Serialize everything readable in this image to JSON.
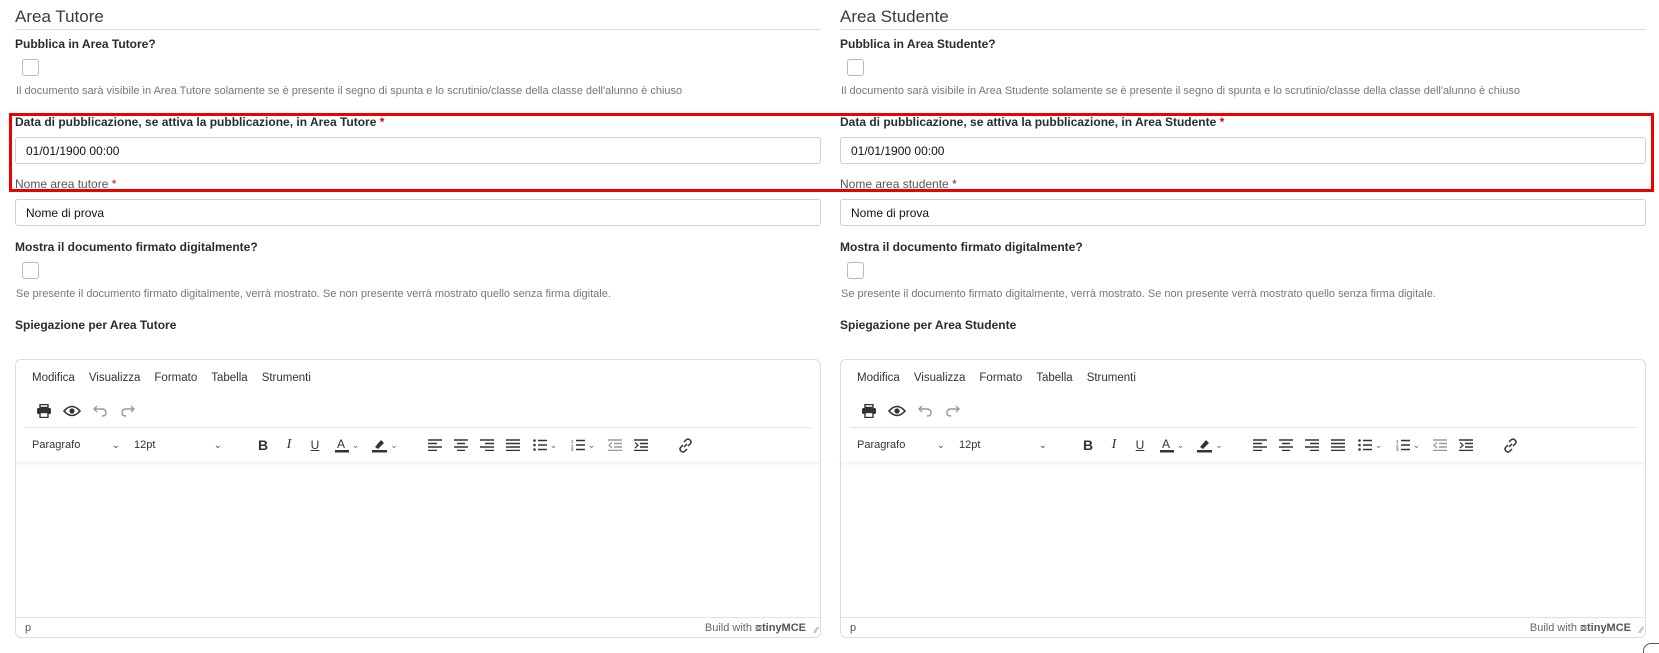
{
  "tutore": {
    "title": "Area Tutore",
    "publish_label": "Pubblica in Area Tutore?",
    "publish_hint": "Il documento sarà visibile in Area Tutore solamente se è presente il segno di spunta e lo scrutinio/classe della classe dell'alunno è chiuso",
    "date_label": "Data di pubblicazione, se attiva la pubblicazione, in Area Tutore",
    "date_value": "01/01/1900 00:00",
    "name_label": "Nome area tutore",
    "name_value": "Nome di prova",
    "signed_label": "Mostra il documento firmato digitalmente?",
    "signed_hint": "Se presente il documento firmato digitalmente, verrà mostrato. Se non presente verrà mostrato quello senza firma digitale.",
    "explain_label": "Spiegazione per Area Tutore"
  },
  "studente": {
    "title": "Area Studente",
    "publish_label": "Pubblica in Area Studente?",
    "publish_hint": "Il documento sarà visibile in Area Studente solamente se è presente il segno di spunta e lo scrutinio/classe della classe dell'alunno è chiuso",
    "date_label": "Data di pubblicazione, se attiva la pubblicazione, in Area Studente",
    "date_value": "01/01/1900 00:00",
    "name_label": "Nome area studente",
    "name_value": "Nome di prova",
    "signed_label": "Mostra il documento firmato digitalmente?",
    "signed_hint": "Se presente il documento firmato digitalmente, verrà mostrato. Se non presente verrà mostrato quello senza firma digitale.",
    "explain_label": "Spiegazione per Area Studente"
  },
  "required_mark": "*",
  "editor": {
    "menu": [
      "Modifica",
      "Visualizza",
      "Formato",
      "Tabella",
      "Strumenti"
    ],
    "block_format": "Paragrafo",
    "font_size": "12pt",
    "status_path": "p",
    "branding_prefix": "Build with",
    "branding_name": "tinyMCE",
    "icons": [
      "print-icon",
      "preview-icon",
      "undo-icon",
      "redo-icon",
      "bold-icon",
      "italic-icon",
      "underline-icon",
      "text-color-icon",
      "highlight-icon",
      "align-left-icon",
      "align-center-icon",
      "align-right-icon",
      "justify-icon",
      "bullet-list-icon",
      "numbered-list-icon",
      "outdent-icon",
      "indent-icon",
      "link-icon"
    ]
  },
  "colors": {
    "required": "#d0021b",
    "highlight": "#ee0000"
  }
}
